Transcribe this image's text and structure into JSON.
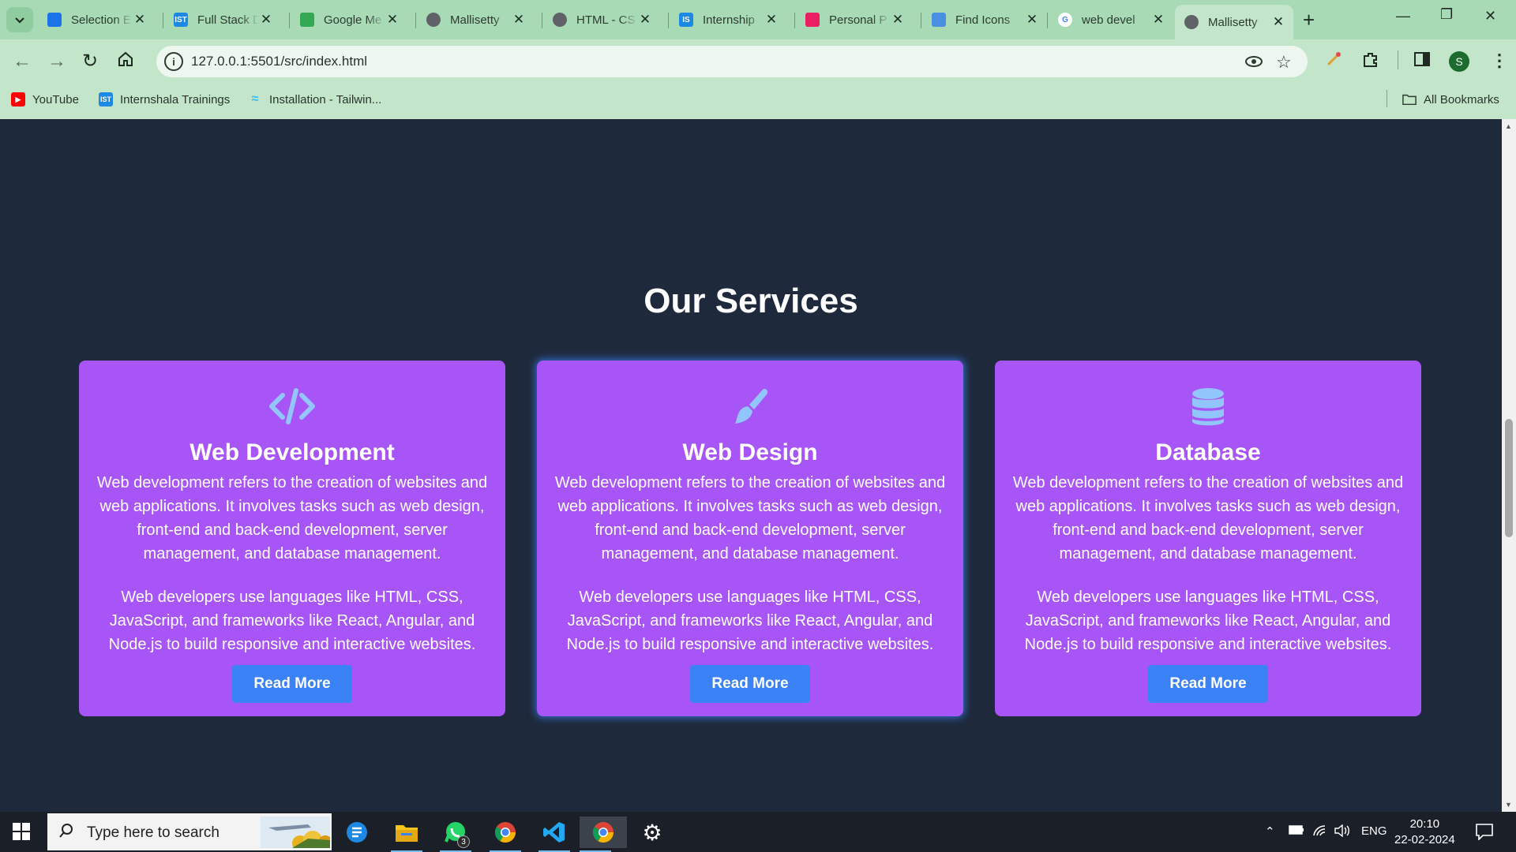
{
  "browser": {
    "tabs": [
      {
        "title": "Selection E",
        "favicon_color": "#1a73e8",
        "favicon_text": ""
      },
      {
        "title": "Full Stack D",
        "favicon_color": "#1e88e5",
        "favicon_text": "IST"
      },
      {
        "title": "Google Me",
        "favicon_color": "#34a853",
        "favicon_text": ""
      },
      {
        "title": "Mallisetty",
        "favicon_color": "#5f6368",
        "favicon_text": ""
      },
      {
        "title": "HTML - CS",
        "favicon_color": "#5f6368",
        "favicon_text": ""
      },
      {
        "title": "Internship",
        "favicon_color": "#1e88e5",
        "favicon_text": "IS"
      },
      {
        "title": "Personal P",
        "favicon_color": "#e91e63",
        "favicon_text": ""
      },
      {
        "title": "Find Icons",
        "favicon_color": "#4a90e2",
        "favicon_text": ""
      },
      {
        "title": "web devel",
        "favicon_color": "#ffffff",
        "favicon_text": "G"
      },
      {
        "title": "Mallisetty",
        "favicon_color": "#5f6368",
        "favicon_text": ""
      }
    ],
    "url": "127.0.0.1:5501/src/index.html",
    "profile_initial": "S",
    "bookmarks": [
      {
        "label": "YouTube",
        "icon": "youtube-icon",
        "color": "#ff0000"
      },
      {
        "label": "Internshala Trainings",
        "icon": "internshala-icon",
        "color": "#1e88e5"
      },
      {
        "label": "Installation - Tailwin...",
        "icon": "tailwind-icon",
        "color": "#38bdf8"
      }
    ],
    "all_bookmarks_label": "All Bookmarks"
  },
  "page": {
    "section_title": "Our Services",
    "accent_color": "#a855f7",
    "button_color": "#3b82f6",
    "cards": [
      {
        "icon": "code-icon",
        "title": "Web Development",
        "p1": "Web development refers to the creation of websites and web applications. It involves tasks such as web design, front-end and back-end development, server management, and database management.",
        "p2": "Web developers use languages like HTML, CSS, JavaScript, and frameworks like React, Angular, and Node.js to build responsive and interactive websites.",
        "button": "Read More"
      },
      {
        "icon": "paintbrush-icon",
        "title": "Web Design",
        "p1": "Web development refers to the creation of websites and web applications. It involves tasks such as web design, front-end and back-end development, server management, and database management.",
        "p2": "Web developers use languages like HTML, CSS, JavaScript, and frameworks like React, Angular, and Node.js to build responsive and interactive websites.",
        "button": "Read More"
      },
      {
        "icon": "database-icon",
        "title": "Database",
        "p1": "Web development refers to the creation of websites and web applications. It involves tasks such as web design, front-end and back-end development, server management, and database management.",
        "p2": "Web developers use languages like HTML, CSS, JavaScript, and frameworks like React, Angular, and Node.js to build responsive and interactive websites.",
        "button": "Read More"
      }
    ]
  },
  "taskbar": {
    "search_placeholder": "Type here to search",
    "whatsapp_badge": "3",
    "language": "ENG",
    "time": "20:10",
    "date": "22-02-2024"
  }
}
